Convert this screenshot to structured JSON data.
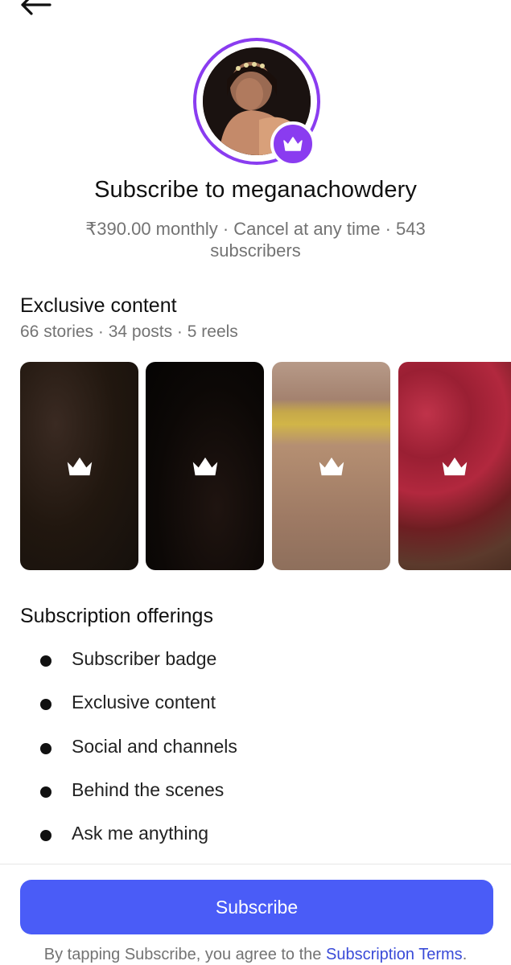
{
  "profile": {
    "title": "Subscribe to meganachowdery",
    "subtitle": "₹390.00 monthly · Cancel at any time · 543 subscribers"
  },
  "exclusive": {
    "heading": "Exclusive content",
    "meta": "66 stories · 34 posts · 5 reels"
  },
  "offerings": {
    "heading": "Subscription offerings",
    "items": [
      "Subscriber badge",
      "Exclusive content",
      "Social and channels",
      "Behind the scenes",
      "Ask me anything"
    ]
  },
  "subscribe": {
    "button_label": "Subscribe",
    "terms_prefix": "By tapping Subscribe, you agree to the ",
    "terms_link": "Subscription Terms",
    "terms_suffix": "."
  },
  "colors": {
    "accent_purple": "#8a3cf0",
    "button_blue": "#4a5cf7",
    "link_blue": "#3a4bd8",
    "muted_text": "#737373"
  },
  "icons": {
    "back": "arrow-left-icon",
    "badge": "crown-icon",
    "bullet": "bullet-dot-icon"
  }
}
